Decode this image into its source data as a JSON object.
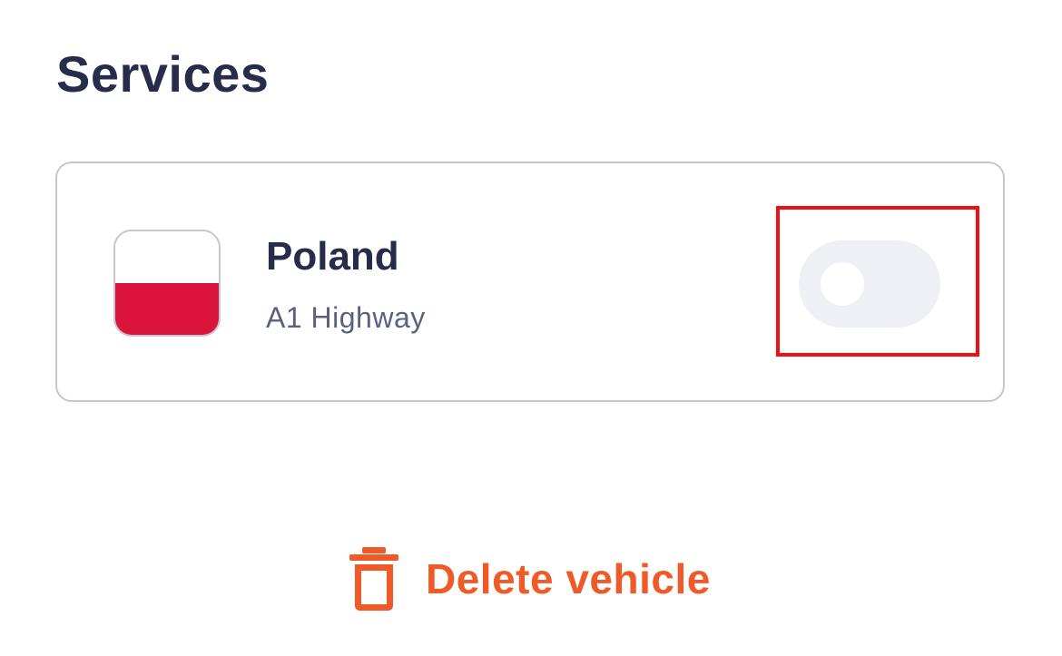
{
  "section": {
    "title": "Services"
  },
  "service": {
    "name": "Poland",
    "subtitle": "A1 Highway",
    "flag_icon": "poland-flag-icon",
    "flag_colors": {
      "top": "#ffffff",
      "bottom": "#dc143c"
    },
    "toggle_enabled": false
  },
  "actions": {
    "delete_label": "Delete vehicle",
    "delete_icon": "trash-icon",
    "delete_color": "#f05a28"
  },
  "colors": {
    "title": "#262c49",
    "subtitle": "#5a6180",
    "highlight": "#f20f0f",
    "toggle_track": "#eff0f5"
  }
}
